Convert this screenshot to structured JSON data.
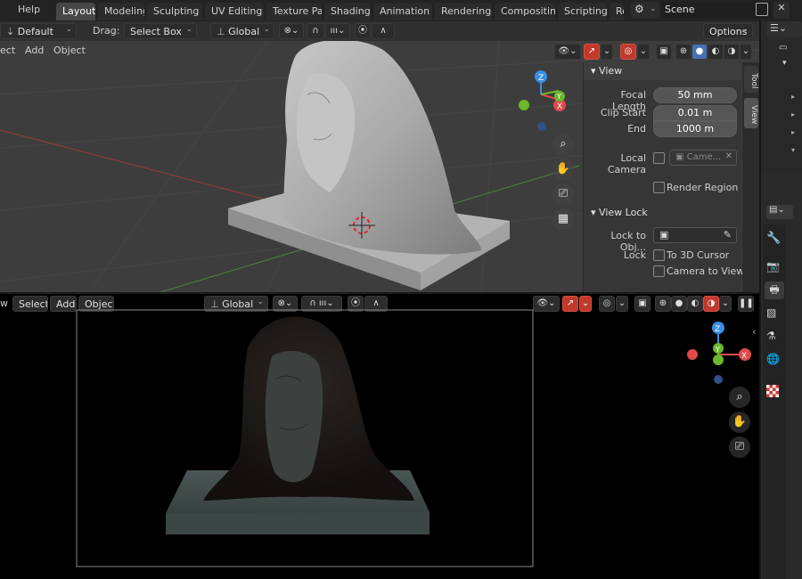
{
  "menu": {
    "help": "Help"
  },
  "workspace_tabs": [
    "Layout",
    "Modeling",
    "Sculpting",
    "UV Editing",
    "Texture Paint",
    "Shading",
    "Animation",
    "Rendering",
    "Compositing",
    "Scripting",
    "Re"
  ],
  "active_tab": "Layout",
  "scene": {
    "name": "Scene"
  },
  "tool_header": {
    "orientation_default": "Default",
    "drag_label": "Drag:",
    "drag_value": "Select Box",
    "transform_orientation": "Global",
    "options": "Options"
  },
  "viewport1": {
    "menu": [
      "ect",
      "Add",
      "Object"
    ]
  },
  "npanel": {
    "section_view": "View",
    "focal_length_label": "Focal Length",
    "focal_length_value": "50 mm",
    "clip_start_label": "Clip Start",
    "clip_start_value": "0.01 m",
    "end_label": "End",
    "end_value": "1000 m",
    "local_camera_label": "Local Camera",
    "local_camera_value": "Came...",
    "render_region_label": "Render Region",
    "section_view_lock": "View Lock",
    "lock_to_obj_label": "Lock to Obj...",
    "lock_label": "Lock",
    "to_3d_cursor": "To 3D Cursor",
    "camera_to_view": "Camera to View",
    "tabs": [
      "Tool",
      "View"
    ]
  },
  "viewport2": {
    "menu": [
      "w",
      "Select",
      "Add",
      "Object"
    ],
    "transform_orientation": "Global"
  },
  "gizmo_labels": {
    "z": "Z",
    "y": "Y",
    "x": "X"
  },
  "colors": {
    "accent_blue": "#4772b3",
    "active_red": "#c0392b",
    "axis_x": "#e04a4a",
    "axis_y": "#6bb82c",
    "axis_z": "#3a8ee6"
  }
}
